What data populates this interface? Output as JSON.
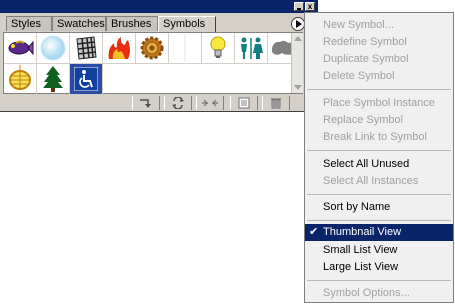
{
  "palette": {
    "tabs": [
      "Styles",
      "Swatches",
      "Brushes",
      "Symbols"
    ],
    "active_tab": "Symbols",
    "close_glyph": "x",
    "symbols": [
      "fish-symbol",
      "bubble-symbol",
      "grid-fabric-symbol",
      "fire-symbol",
      "cog-symbol",
      "blank-symbol",
      "light-bulb-symbol",
      "restroom-symbol",
      "smoke-blot-symbol",
      "lantern-symbol",
      "pine-tree-symbol",
      "wheelchair-symbol"
    ],
    "selected_symbol": "wheelchair-symbol",
    "bottom_buttons": [
      "place-symbol-icon",
      "replace-symbol-icon",
      "break-link-icon",
      "new-symbol-icon",
      "trash-icon"
    ]
  },
  "menu": {
    "checkmark": "✔",
    "items": [
      {
        "label": "New Symbol...",
        "disabled": true
      },
      {
        "label": "Redefine Symbol",
        "disabled": true
      },
      {
        "label": "Duplicate Symbol",
        "disabled": true
      },
      {
        "label": "Delete Symbol",
        "disabled": true
      },
      {
        "label": "Place Symbol Instance",
        "disabled": true
      },
      {
        "label": "Replace Symbol",
        "disabled": true
      },
      {
        "label": "Break Link to Symbol",
        "disabled": true
      },
      {
        "label": "Select All Unused",
        "disabled": false
      },
      {
        "label": "Select All Instances",
        "disabled": true
      },
      {
        "label": "Sort by Name",
        "disabled": false
      },
      {
        "label": "Thumbnail View",
        "disabled": false,
        "checked": true,
        "highlighted": true
      },
      {
        "label": "Small List View",
        "disabled": false
      },
      {
        "label": "Large List View",
        "disabled": false
      },
      {
        "label": "Symbol Options...",
        "disabled": true
      }
    ]
  },
  "colors": {
    "titlebar": "#0a246a",
    "highlight": "#0a246a",
    "disabled_text": "#a0a0a0",
    "selection": "#2b4aa0"
  }
}
